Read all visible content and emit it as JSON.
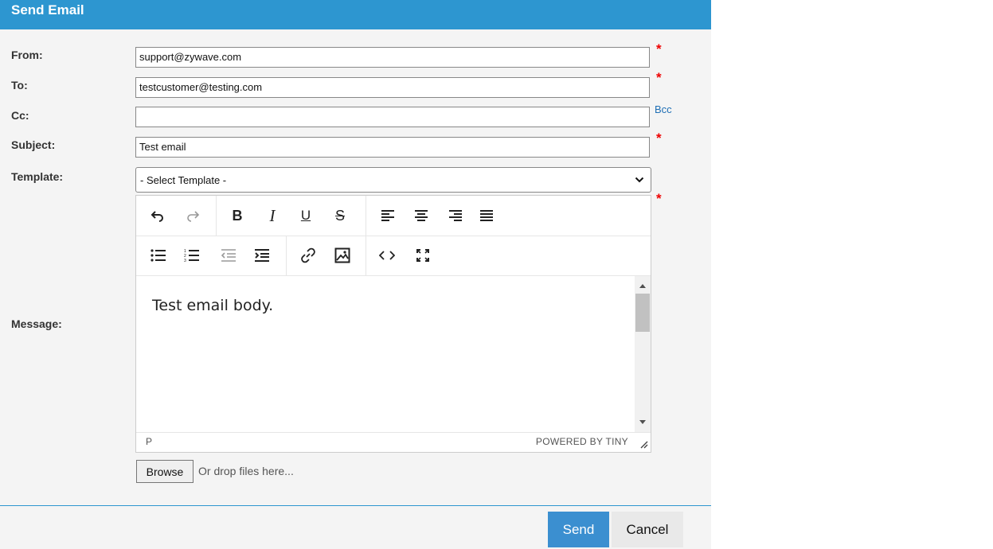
{
  "title": "Send Email",
  "labels": {
    "from": "From:",
    "to": "To:",
    "cc": "Cc:",
    "subject": "Subject:",
    "template": "Template:",
    "message": "Message:"
  },
  "fields": {
    "from": "support@zywave.com",
    "to": "testcustomer@testing.com",
    "cc": "",
    "subject": "Test email"
  },
  "required_mark": "*",
  "bcc_link": "Bcc",
  "template_select": {
    "selected": "- Select Template -"
  },
  "editor": {
    "toolbar_row1": [
      "undo-icon",
      "redo-icon",
      "bold-icon",
      "italic-icon",
      "underline-icon",
      "strikethrough-icon",
      "align-left-icon",
      "align-center-icon",
      "align-right-icon",
      "justify-icon"
    ],
    "toolbar_row2": [
      "bullet-list-icon",
      "numbered-list-icon",
      "outdent-icon",
      "indent-icon",
      "link-icon",
      "image-icon",
      "source-code-icon",
      "fullscreen-icon"
    ],
    "body": "Test email body.",
    "status_path": "P",
    "powered_by": "POWERED BY TINY"
  },
  "attachments": {
    "browse_label": "Browse",
    "drop_text": "Or drop files here..."
  },
  "actions": {
    "send": "Send",
    "cancel": "Cancel"
  },
  "colors": {
    "titlebar": "#2d96d0",
    "send_button": "#3b8fd0",
    "required": "#ee0000",
    "link": "#1f6fb5"
  }
}
